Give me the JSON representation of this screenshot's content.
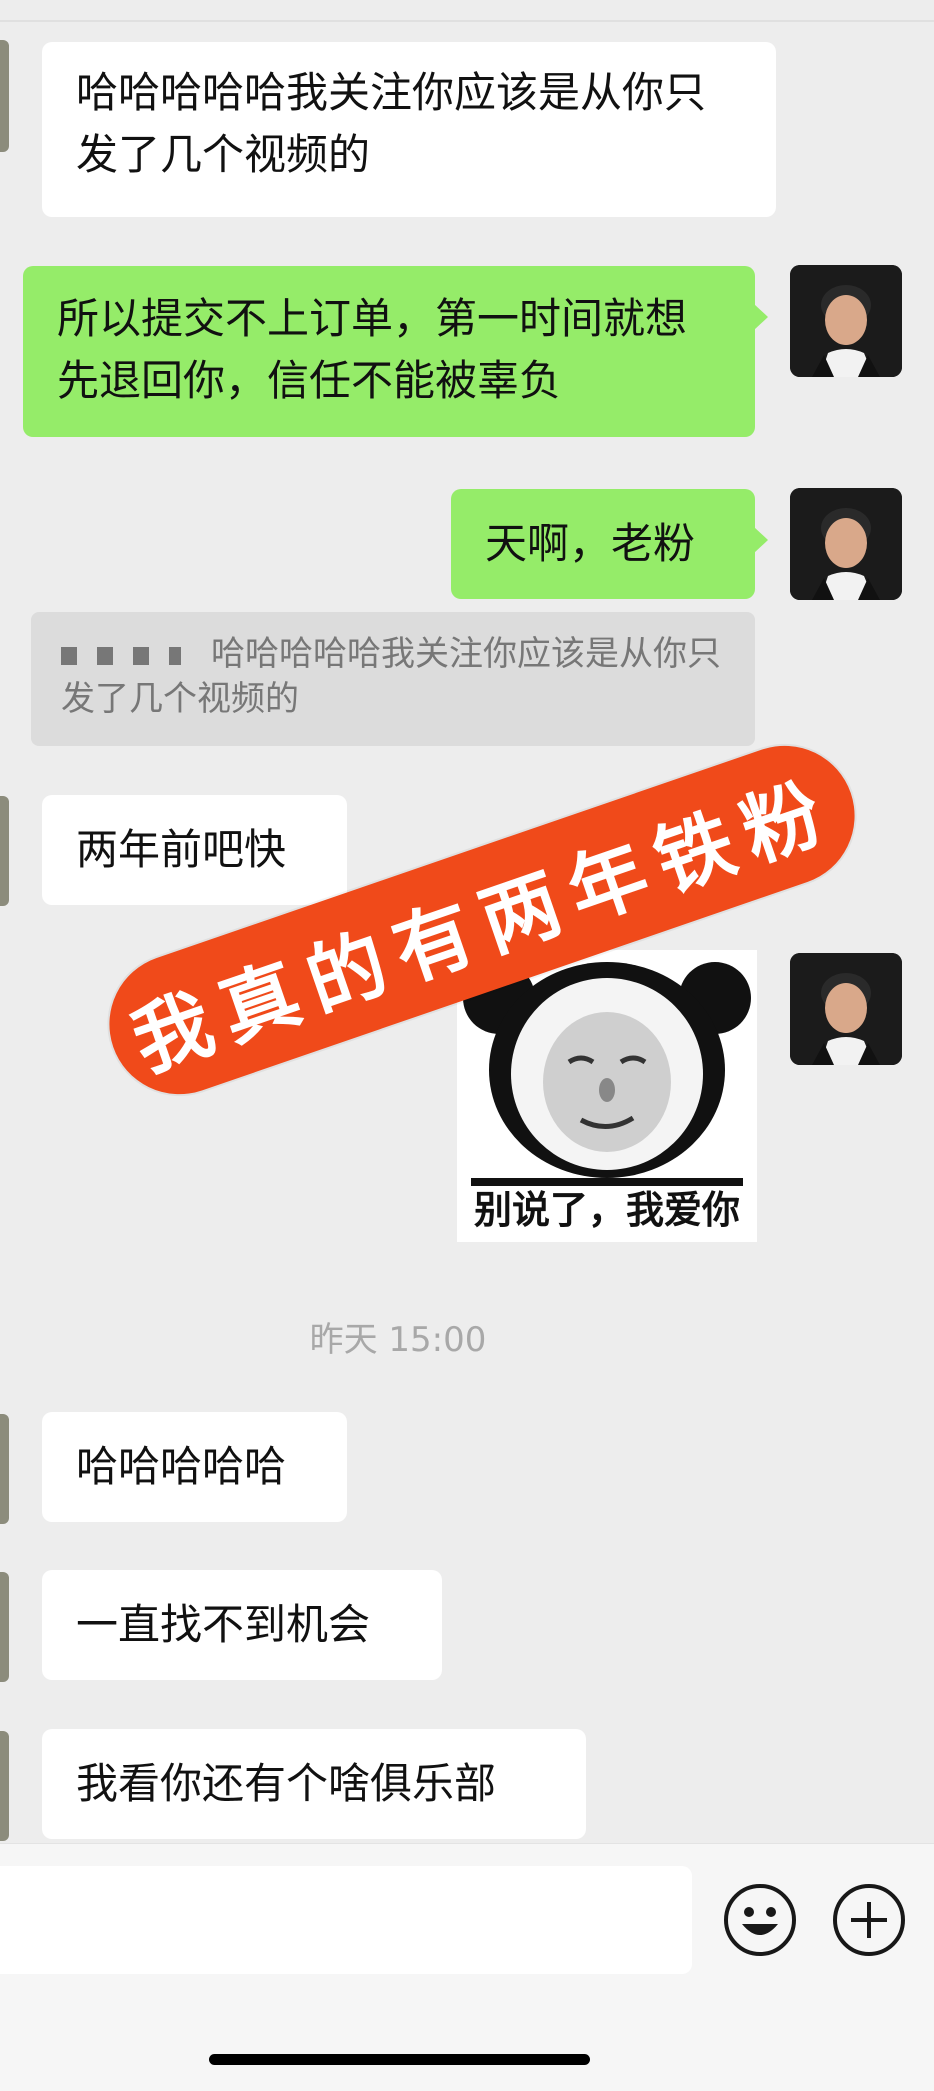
{
  "messages": [
    {
      "text": "哈哈哈哈哈我关注你应该是从你只发了几个视频的"
    },
    {
      "text": "所以提交不上订单，第一时间就想先退回你，信任不能被辜负"
    },
    {
      "text": "天啊，老粉"
    },
    {
      "text": "两年前吧快"
    },
    {
      "text": "哈哈哈哈哈"
    },
    {
      "text": "一直找不到机会"
    },
    {
      "text": "我看你还有个啥俱乐部"
    }
  ],
  "quote": {
    "text": "哈哈哈哈哈我关注你应该是从你只发了几个视频的"
  },
  "sticker": {
    "caption": "别说了，我爱你"
  },
  "timestamp": "昨天 15:00",
  "banner": "我真的有两年铁粉",
  "icons": [
    "emoji-icon",
    "plus-icon"
  ]
}
